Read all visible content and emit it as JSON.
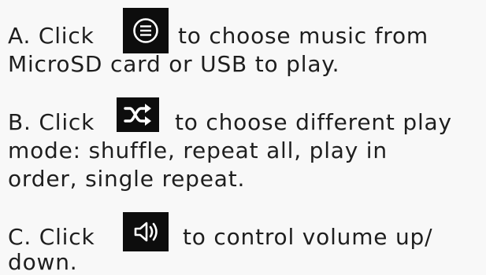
{
  "instructions": {
    "a": {
      "prefix": "A. Click",
      "icon": "list-menu-icon",
      "line1_rest": "to choose music from",
      "line2": "MicroSD card or USB to play."
    },
    "b": {
      "prefix": "B. Click",
      "icon": "shuffle-icon",
      "line1_rest": "to choose different play",
      "line2": "mode: shuffle, repeat all, play in",
      "line3": "order, single repeat."
    },
    "c": {
      "prefix": "C. Click",
      "icon": "volume-icon",
      "line1_rest": "to control volume up/",
      "line2": "down."
    }
  },
  "colors": {
    "background": "#f8f8f8",
    "text": "#1e1e1e",
    "icon_background": "#0d0d0d",
    "icon_foreground": "#ffffff"
  }
}
